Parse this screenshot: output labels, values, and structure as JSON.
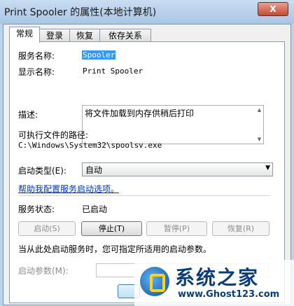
{
  "window": {
    "title": "Print Spooler 的属性(本地计算机)",
    "close_label": "X"
  },
  "tabs": [
    "常规",
    "登录",
    "恢复",
    "依存关系"
  ],
  "general": {
    "service_name_label": "服务名称:",
    "service_name_value": "Spooler",
    "display_name_label": "显示名称:",
    "display_name_value": "Print Spooler",
    "description_label": "描述:",
    "description_value": "将文件加载到内存供稍后打印",
    "exe_path_label": "可执行文件的路径:",
    "exe_path_value": "C:\\Windows\\System32\\spoolsv.exe",
    "startup_type_label": "启动类型(E):",
    "startup_type_value": "自动",
    "help_link": "帮助我配置服务启动选项。",
    "status_label": "服务状态:",
    "status_value": "已启动",
    "buttons": {
      "start": "启动(S)",
      "stop": "停止(T)",
      "pause": "暂停(P)",
      "resume": "恢复(R)"
    },
    "hint": "当从此处启动服务时，您可指定所适用的启动参数。",
    "start_params_label": "启动参数(M):",
    "start_params_value": ""
  },
  "watermark": {
    "name": "系统之家",
    "url": "www.Ghost123.com"
  }
}
